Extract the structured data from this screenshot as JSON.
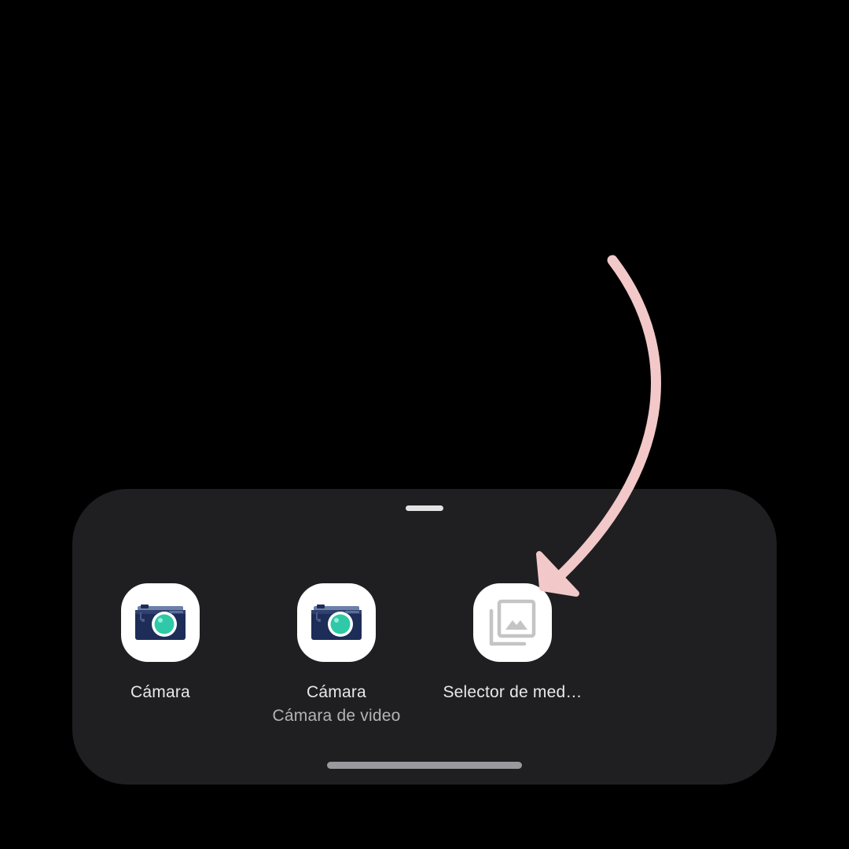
{
  "colors": {
    "background": "#000000",
    "sheet": "#1f1f22",
    "icon_bg": "#ffffff",
    "label": "#e9e9ea",
    "sublabel": "#b4b4b8",
    "arrow": "#f2c8c8",
    "camera_body": "#1e2d57",
    "camera_lens": "#2fc9a7",
    "gallery_icon": "#b9b9b9"
  },
  "share_sheet": {
    "apps": [
      {
        "label": "Cámara",
        "sublabel": "",
        "icon": "camera-icon"
      },
      {
        "label": "Cámara",
        "sublabel": "Cámara de video",
        "icon": "camera-icon"
      },
      {
        "label": "Selector de med…",
        "sublabel": "",
        "icon": "gallery-icon"
      }
    ]
  },
  "annotation": {
    "icon": "curved-arrow-icon",
    "points_to": "Selector de med…"
  }
}
